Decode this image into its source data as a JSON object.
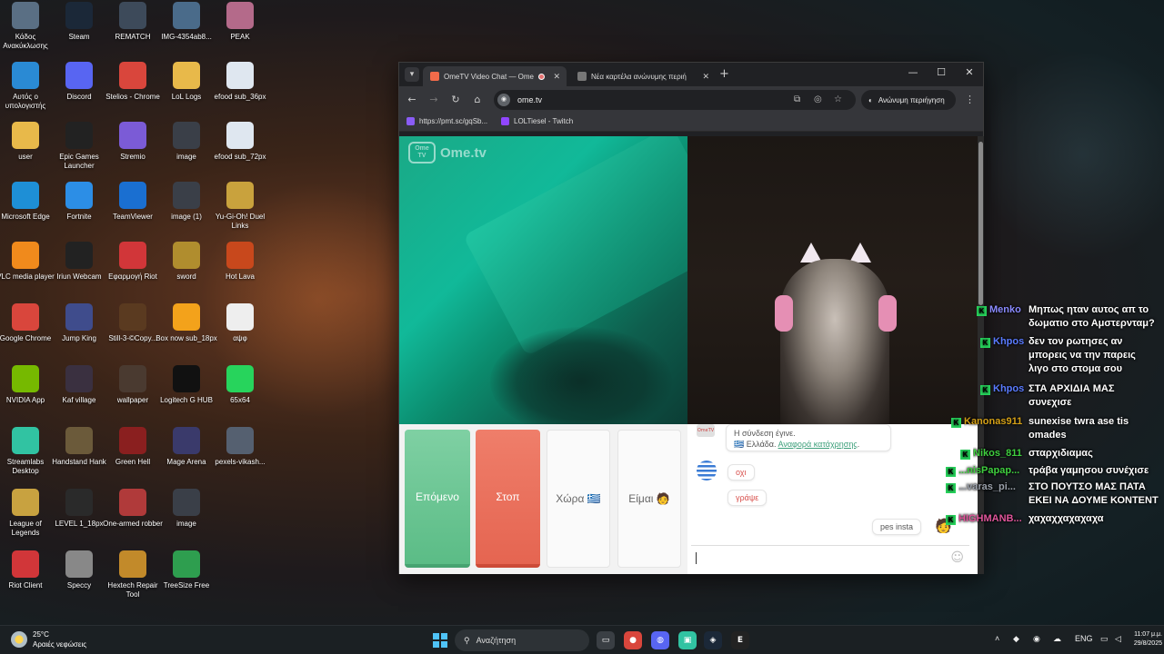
{
  "desktop": {
    "icons": [
      {
        "label": "Κάδος Ανακύκλωσης",
        "icon": "recycle-bin-icon",
        "color": "#5a6f84"
      },
      {
        "label": "Steam",
        "icon": "steam-icon",
        "color": "#1b2838"
      },
      {
        "label": "REMATCH",
        "icon": "rematch-icon",
        "color": "#3d4a5a"
      },
      {
        "label": "IMG-4354ab8...",
        "icon": "image-file-icon",
        "color": "#4a6b8a"
      },
      {
        "label": "PEAK",
        "icon": "peak-icon",
        "color": "#b46a8a"
      },
      {
        "label": "Αυτός ο υπολογιστής",
        "icon": "this-pc-icon",
        "color": "#2a8ad4"
      },
      {
        "label": "Discord",
        "icon": "discord-icon",
        "color": "#5865f2"
      },
      {
        "label": "Stelios - Chrome",
        "icon": "chrome-icon",
        "color": "#d9463c"
      },
      {
        "label": "LoL Logs",
        "icon": "folder-icon",
        "color": "#e8b94a"
      },
      {
        "label": "efood sub_36px",
        "icon": "image-file-icon",
        "color": "#dfe7f0"
      },
      {
        "label": "user",
        "icon": "folder-icon",
        "color": "#e8b94a"
      },
      {
        "label": "Epic Games Launcher",
        "icon": "epic-games-icon",
        "color": "#222222"
      },
      {
        "label": "Stremio",
        "icon": "stremio-icon",
        "color": "#7b5bd6"
      },
      {
        "label": "image",
        "icon": "image-file-icon",
        "color": "#3a3f48"
      },
      {
        "label": "efood sub_72px",
        "icon": "image-file-icon",
        "color": "#dfe7f0"
      },
      {
        "label": "Microsoft Edge",
        "icon": "edge-icon",
        "color": "#1e8fd6"
      },
      {
        "label": "Fortnite",
        "icon": "fortnite-icon",
        "color": "#2c8ee6"
      },
      {
        "label": "TeamViewer",
        "icon": "teamviewer-icon",
        "color": "#1a6fd1"
      },
      {
        "label": "image (1)",
        "icon": "image-file-icon",
        "color": "#3a3f48"
      },
      {
        "label": "Yu-Gi-Oh! Duel Links",
        "icon": "yugioh-icon",
        "color": "#c9a23d"
      },
      {
        "label": "VLC media player",
        "icon": "vlc-icon",
        "color": "#f08a1c"
      },
      {
        "label": "Iriun Webcam",
        "icon": "webcam-icon",
        "color": "#222222"
      },
      {
        "label": "Εφαρμογή Riot",
        "icon": "riot-icon",
        "color": "#d13639"
      },
      {
        "label": "sword",
        "icon": "sword-icon",
        "color": "#b08d2e"
      },
      {
        "label": "Hot Lava",
        "icon": "hot-lava-icon",
        "color": "#c8481c"
      },
      {
        "label": "Google Chrome",
        "icon": "chrome-icon",
        "color": "#d9463c"
      },
      {
        "label": "Jump King",
        "icon": "jump-king-icon",
        "color": "#3f4c8c"
      },
      {
        "label": "Still-3-©Copy...",
        "icon": "image-file-icon",
        "color": "#5a3a20"
      },
      {
        "label": "Box now sub_18px",
        "icon": "image-file-icon",
        "color": "#f3a21b"
      },
      {
        "label": "αψφ",
        "icon": "text-file-icon",
        "color": "#eeeeee"
      },
      {
        "label": "NVIDIA App",
        "icon": "nvidia-icon",
        "color": "#76b900"
      },
      {
        "label": "Kaf village",
        "icon": "image-file-icon",
        "color": "#3a3040"
      },
      {
        "label": "wallpaper",
        "icon": "image-file-icon",
        "color": "#4a3a30"
      },
      {
        "label": "Logitech G HUB",
        "icon": "logitech-icon",
        "color": "#111111"
      },
      {
        "label": "65x64",
        "icon": "kick-icon",
        "color": "#27d45c"
      },
      {
        "label": "Streamlabs Desktop",
        "icon": "streamlabs-icon",
        "color": "#31c3a2"
      },
      {
        "label": "Handstand Hank",
        "icon": "game-icon",
        "color": "#6b5a3a"
      },
      {
        "label": "Green Hell",
        "icon": "green-hell-icon",
        "color": "#8a1f1f"
      },
      {
        "label": "Mage Arena",
        "icon": "game-icon",
        "color": "#3a3a6b"
      },
      {
        "label": "pexels-vikash...",
        "icon": "image-file-icon",
        "color": "#556070"
      },
      {
        "label": "League of Legends",
        "icon": "league-icon",
        "color": "#c8a240"
      },
      {
        "label": "LEVEL 1_18px",
        "icon": "image-file-icon",
        "color": "#2a2a2a"
      },
      {
        "label": "One-armed robber",
        "icon": "game-icon",
        "color": "#b03a3a"
      },
      {
        "label": "image",
        "icon": "image-file-icon",
        "color": "#3a3f48"
      },
      {
        "label": "",
        "icon": "empty",
        "color": ""
      },
      {
        "label": "Riot Client",
        "icon": "riot-icon",
        "color": "#d13639"
      },
      {
        "label": "Speccy",
        "icon": "speccy-icon",
        "color": "#888888"
      },
      {
        "label": "Hextech Repair Tool",
        "icon": "hextech-icon",
        "color": "#c28a2a"
      },
      {
        "label": "TreeSize Free",
        "icon": "treesize-icon",
        "color": "#2e9e4f"
      }
    ]
  },
  "browser": {
    "tabs": [
      {
        "title": "OmeTV Video Chat — Ome",
        "active": true
      },
      {
        "title": "Νέα καρτέλα ανώνυμης περιή",
        "active": false
      }
    ],
    "url": "ome.tv",
    "incognito_label": "Ανώνυμη περιήγηση",
    "bookmarks": [
      {
        "label": "https://pmt.sc/gqSb...",
        "color": "#8a5cf6"
      },
      {
        "label": "LOLTiesel - Twitch",
        "color": "#9146ff"
      }
    ]
  },
  "ometv": {
    "logo_text": "Ome.tv",
    "logo_badge": "Ome TV",
    "buttons": {
      "next": "Επόμενο",
      "stop": "Στοπ",
      "country": "Χώρα 🇬🇷",
      "me": "Είμαι 🧑"
    },
    "chat": {
      "system_line1": "Η σύνδεση έγινε.",
      "system_country": "🇬🇷 Ελλάδα.",
      "system_report": "Αναφορά κατάχρησης",
      "system_report_end": ".",
      "messages": [
        {
          "text": "οχι",
          "from": "stranger"
        },
        {
          "text": "γράψε",
          "from": "stranger"
        },
        {
          "text": "pes insta",
          "from": "me"
        }
      ],
      "input_value": ""
    }
  },
  "twitch_chat": [
    {
      "user": "Menko",
      "color": "#8a8aff",
      "lines": [
        "Μηπως ηταν αυτος απ το",
        "δωματιο στο Αμστερνταμ?"
      ]
    },
    {
      "user": "Khpos",
      "color": "#5a7bff",
      "lines": [
        "δεν τον ρωτησες αν",
        "μπορεις να την παρεις",
        "λιγο στο στομα σου"
      ]
    },
    {
      "user": "Khpos",
      "color": "#5a7bff",
      "lines": [
        "ΣΤΑ ΑΡΧΙΔΙΑ ΜΑΣ",
        "συνεχισε"
      ]
    },
    {
      "user": "Kanonas911",
      "color": "#d4a017",
      "lines": [
        "sunexise twra ase tis",
        "omades"
      ]
    },
    {
      "user": "Nikos_811",
      "color": "#3fcf3f",
      "lines": [
        "σταρχιδιαμας"
      ]
    },
    {
      "user": "...nisPapap...",
      "color": "#3fcf3f",
      "lines": [
        "τράβα γαμησου συνέχισε"
      ]
    },
    {
      "user": "...varas_pi...",
      "color": "#9aa0aa",
      "lines": [
        "ΣΤΟ ΠΟΥΤΣΟ ΜΑΣ ΠΑΤΑ",
        "ΕΚΕΙ ΝΑ ΔΟΥΜΕ ΚΟΝΤΕΝΤ"
      ]
    },
    {
      "user": "HIGHMANB...",
      "color": "#e0559a",
      "lines": [
        "χαχαχχαχαχαχα"
      ]
    }
  ],
  "taskbar": {
    "weather_temp": "25°C",
    "weather_desc": "Αραιές νεφώσεις",
    "search_placeholder": "Αναζήτηση",
    "lang": "ENG",
    "time": "11:07 μ.μ.",
    "date": "29/8/2025",
    "apps": [
      {
        "icon": "task-view-icon",
        "color": "#3a3f44"
      },
      {
        "icon": "chrome-icon",
        "color": "#d9463c"
      },
      {
        "icon": "discord-icon",
        "color": "#5865f2"
      },
      {
        "icon": "streamlabs-icon",
        "color": "#31c3a2"
      },
      {
        "icon": "steam-icon",
        "color": "#1b2838"
      },
      {
        "icon": "epic-games-icon",
        "color": "#222222"
      }
    ]
  },
  "colors": {
    "next": "#5bbc86",
    "stop": "#e56551",
    "link": "#3c9f7a",
    "kick": "#27d45c"
  }
}
